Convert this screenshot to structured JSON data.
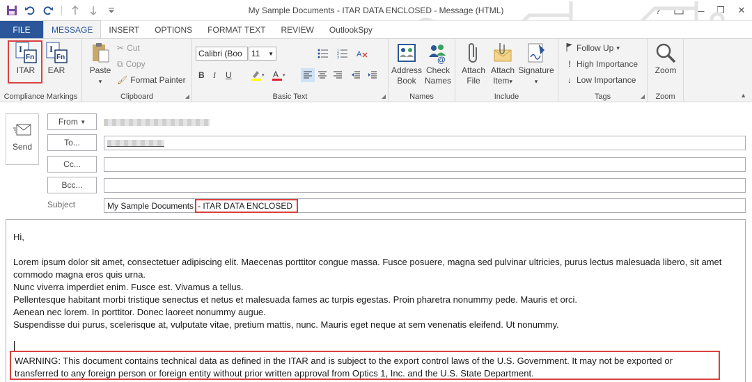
{
  "window": {
    "title": "My Sample Documents - ITAR DATA ENCLOSED - Message (HTML)",
    "help": "?",
    "minimize": "—",
    "restore": "❐",
    "close": "✕"
  },
  "tabs": [
    {
      "label": "FILE"
    },
    {
      "label": "MESSAGE"
    },
    {
      "label": "INSERT"
    },
    {
      "label": "OPTIONS"
    },
    {
      "label": "FORMAT TEXT"
    },
    {
      "label": "REVIEW"
    },
    {
      "label": "OutlookSpy"
    }
  ],
  "ribbon": {
    "compliance": {
      "label": "Compliance Markings",
      "itar": "ITAR",
      "ear": "EAR",
      "fn": "Fn"
    },
    "clipboard": {
      "label": "Clipboard",
      "paste": "Paste",
      "cut": "Cut",
      "copy": "Copy",
      "format_painter": "Format Painter"
    },
    "basic_text": {
      "label": "Basic Text",
      "font": "Calibri (Boo",
      "size": "11",
      "bold": "B",
      "italic": "I",
      "underline": "U"
    },
    "names": {
      "label": "Names",
      "address_book_1": "Address",
      "address_book_2": "Book",
      "check_names_1": "Check",
      "check_names_2": "Names"
    },
    "include": {
      "label": "Include",
      "attach_file_1": "Attach",
      "attach_file_2": "File",
      "attach_item_1": "Attach",
      "attach_item_2": "Item",
      "signature": "Signature"
    },
    "tags": {
      "label": "Tags",
      "follow_up": "Follow Up",
      "high": "High Importance",
      "low": "Low Importance"
    },
    "zoom": {
      "label": "Zoom",
      "zoom": "Zoom"
    }
  },
  "compose": {
    "send": "Send",
    "from": "From",
    "to": "To...",
    "cc": "Cc...",
    "bcc": "Bcc...",
    "subject_label": "Subject",
    "subject_main": "My Sample Documents",
    "subject_marking": "- ITAR DATA ENCLOSED"
  },
  "body": {
    "greeting": "Hi,",
    "para1": "Lorem ipsum dolor sit amet, consectetuer adipiscing elit. Maecenas porttitor congue massa. Fusce posuere, magna sed pulvinar ultricies, purus lectus malesuada libero, sit amet commodo magna eros quis urna.",
    "line2": "Nunc viverra imperdiet enim. Fusce est. Vivamus a tellus.",
    "line3": "Pellentesque habitant morbi tristique senectus et netus et malesuada fames ac turpis egestas. Proin pharetra nonummy pede. Mauris et orci.",
    "line4": "Aenean nec lorem. In porttitor. Donec laoreet nonummy augue.",
    "line5": "Suspendisse dui purus, scelerisque at, vulputate vitae, pretium mattis, nunc. Mauris eget neque at sem venenatis eleifend. Ut nonummy.",
    "warning": "WARNING: This document contains technical data as defined in the ITAR and is subject to the export control laws of the U.S. Government. It may not be exported or transferred to any foreign person or foreign entity without prior written approval from Optics 1, Inc. and the U.S. State Department."
  },
  "colors": {
    "accent": "#2b579a",
    "highlight_box": "#d9413f"
  }
}
